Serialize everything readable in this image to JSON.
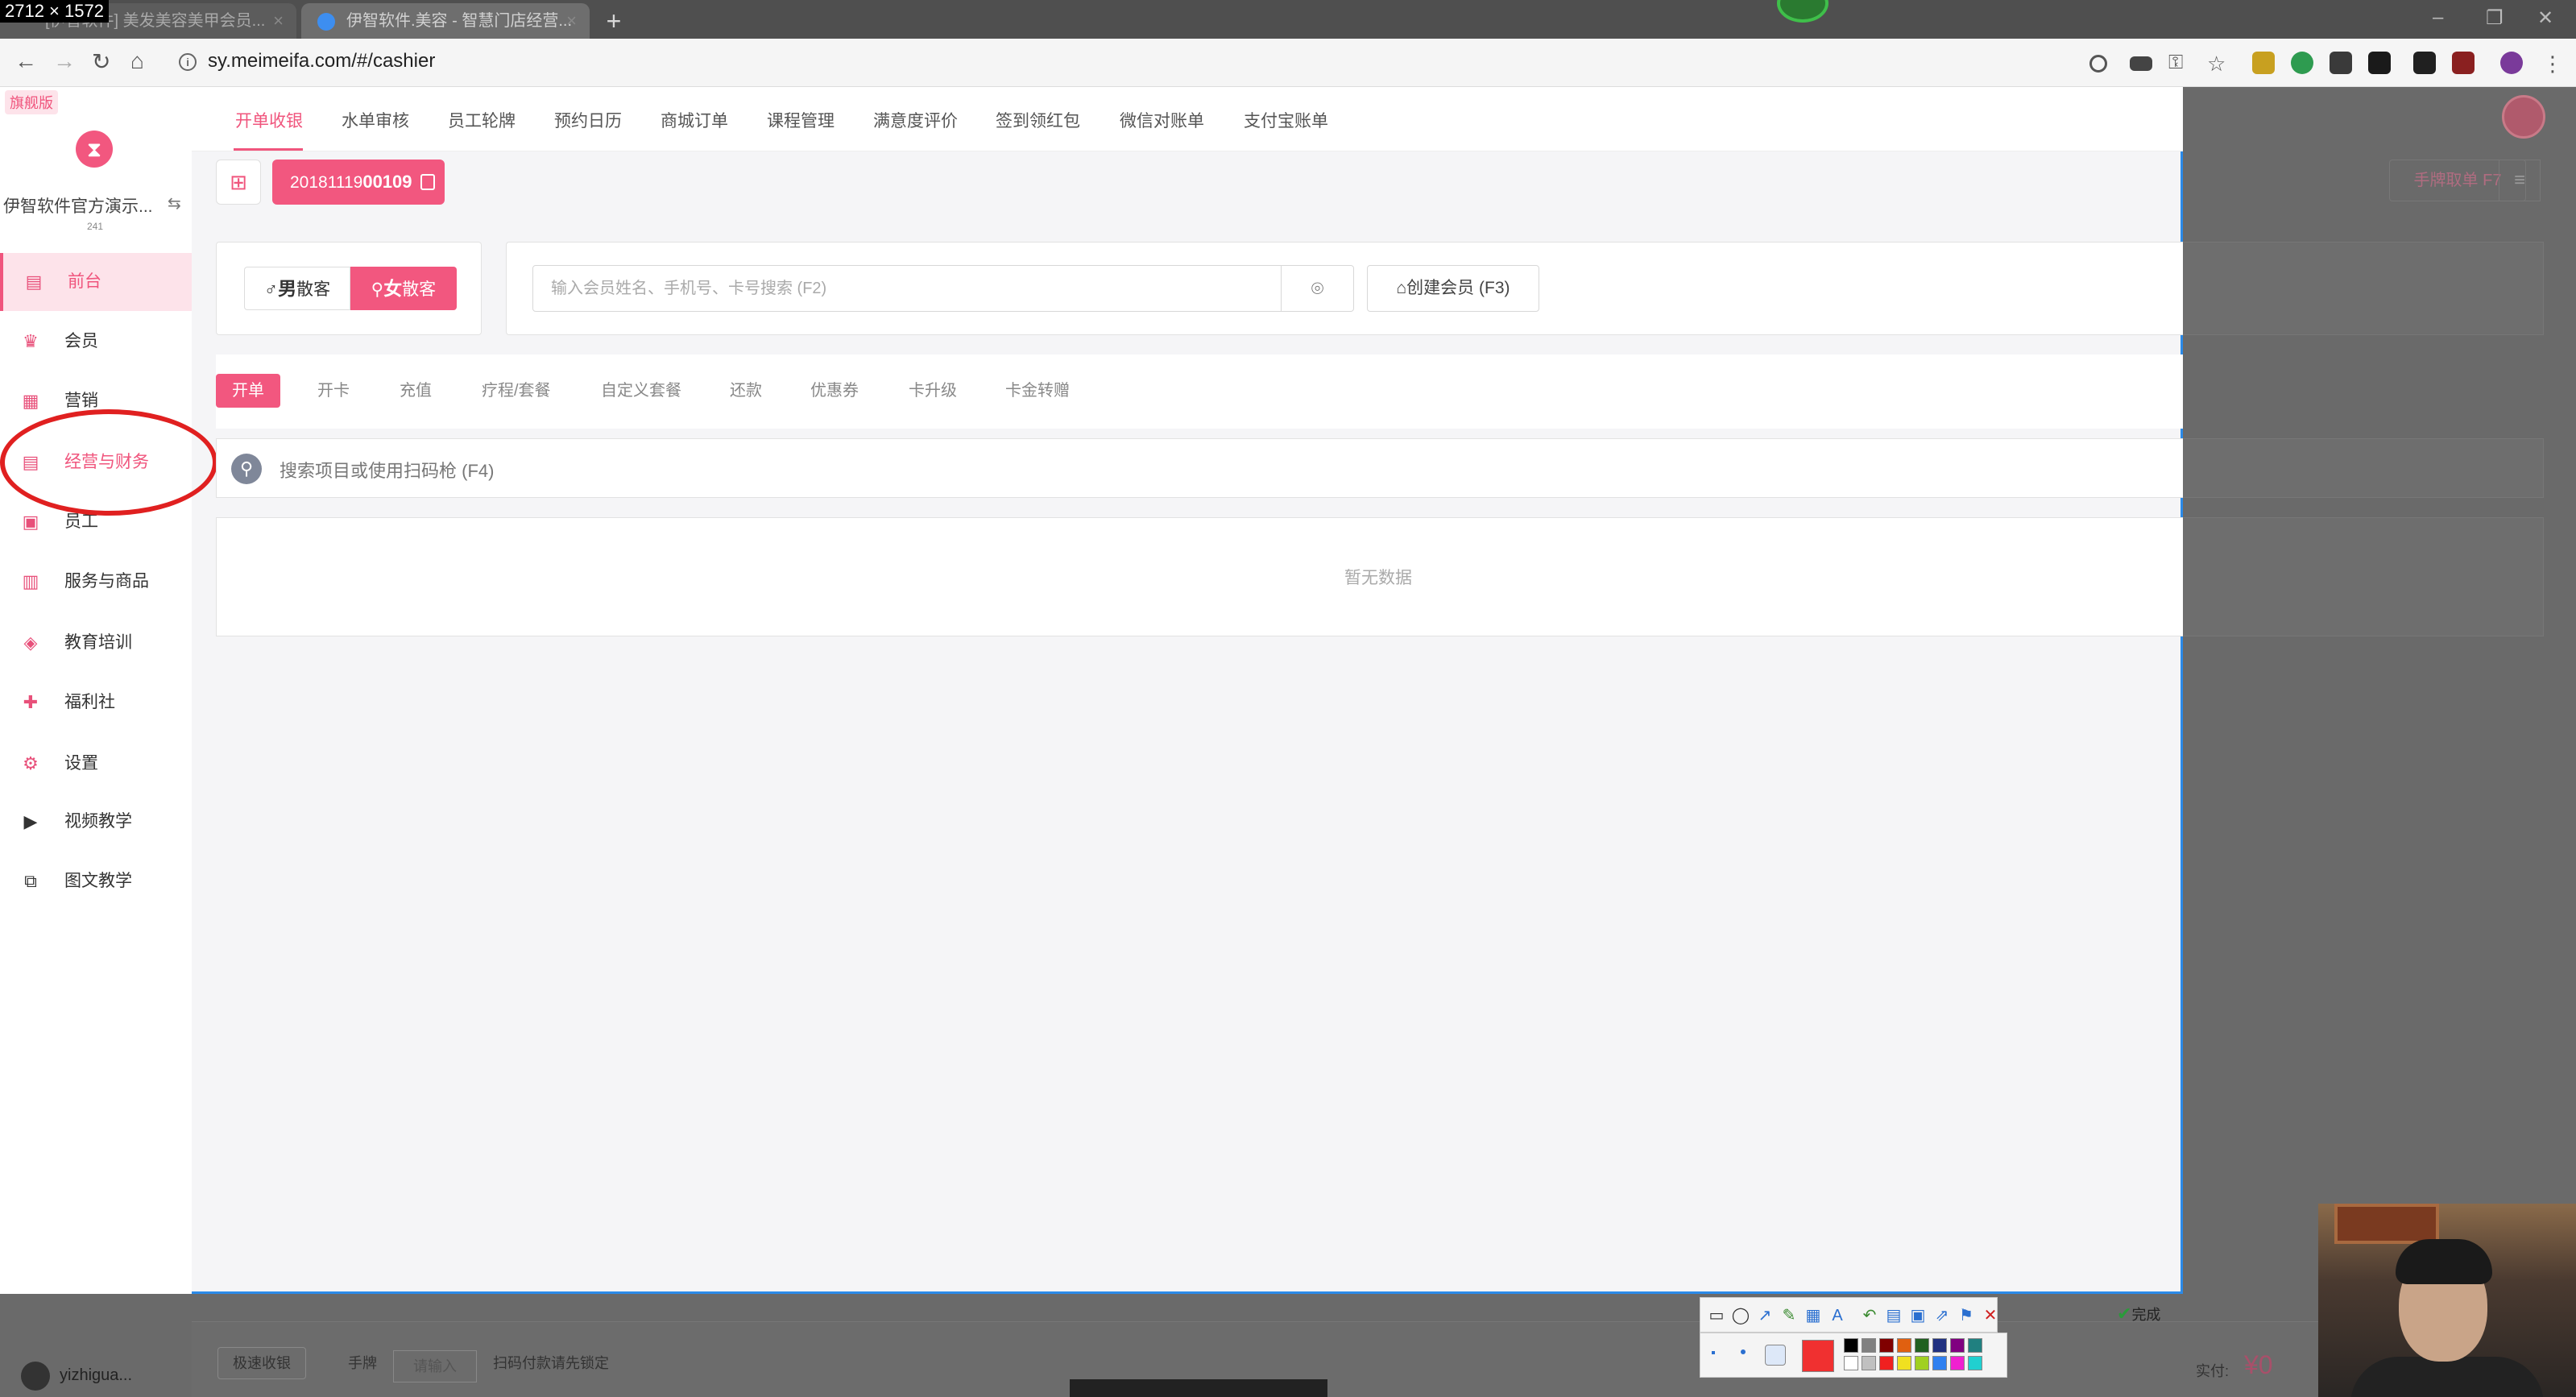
{
  "screen_label": "2712 × 1572",
  "browser": {
    "tabs": [
      {
        "title": "[伊智软件] 美发美容美甲会员..."
      },
      {
        "title": "伊智软件.美容 - 智慧门店经营..."
      }
    ],
    "new_tab": "+",
    "url": "sy.meimeifa.com/#/cashier"
  },
  "sidebar": {
    "edition": "旗舰版",
    "store_name": "伊智软件官方演示...",
    "store_id": "241",
    "items": [
      {
        "label": "前台",
        "icon": "monitor-icon"
      },
      {
        "label": "会员",
        "icon": "crown-icon"
      },
      {
        "label": "营销",
        "icon": "megaphone-icon"
      },
      {
        "label": "经营与财务",
        "icon": "finance-icon"
      },
      {
        "label": "员工",
        "icon": "staff-icon"
      },
      {
        "label": "服务与商品",
        "icon": "goods-icon"
      },
      {
        "label": "教育培训",
        "icon": "education-icon"
      },
      {
        "label": "福利社",
        "icon": "gift-icon"
      },
      {
        "label": "设置",
        "icon": "gear-icon"
      },
      {
        "label": "视频教学",
        "icon": "video-icon"
      },
      {
        "label": "图文教学",
        "icon": "article-icon"
      }
    ],
    "user": "yizhigua..."
  },
  "topnav": {
    "items": [
      "开单收银",
      "水单审核",
      "员工轮牌",
      "预约日历",
      "商城订单",
      "课程管理",
      "满意度评价",
      "签到领红包",
      "微信对账单",
      "支付宝账单"
    ]
  },
  "order": {
    "number_prefix": "20181119",
    "number_suffix": "00109"
  },
  "guest": {
    "male_symbol": "♂",
    "male_strong": "男",
    "male_rest": "散客",
    "female_strong": "女",
    "female_rest": "散客"
  },
  "member_search": {
    "placeholder": "输入会员姓名、手机号、卡号搜索 (F2)",
    "create_label": "创建会员 (F3)"
  },
  "subtabs": [
    "开单",
    "开卡",
    "充值",
    "疗程/套餐",
    "自定义套餐",
    "还款",
    "优惠券",
    "卡升级",
    "卡金转赠"
  ],
  "item_search": {
    "placeholder": "搜索项目或使用扫码枪 (F4)"
  },
  "table": {
    "empty_text": "暂无数据"
  },
  "right_panel": {
    "hand_order": "手牌取单 F7"
  },
  "bottom_bar": {
    "quick_cash": "极速收银",
    "hand_card": "手牌",
    "please_input": "请输入",
    "scan_hint": "扫码付款请先锁定",
    "actual_pay": "实付:",
    "amount": "¥0"
  },
  "snip_tool": {
    "done": "完成"
  },
  "colors": {
    "brand": "#f2577f",
    "annotation": "#e02020"
  }
}
